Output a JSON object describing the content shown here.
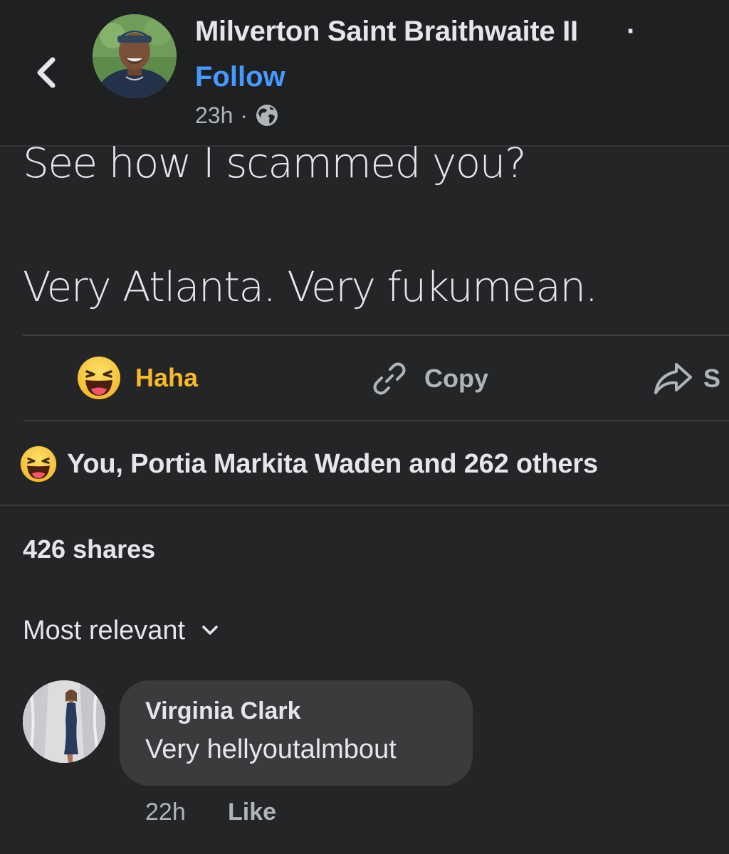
{
  "header": {
    "back_icon": "chevron-left-icon",
    "author_name": "Milverton Saint Braithwaite II",
    "name_separator": "·",
    "follow_label": "Follow",
    "time_ago": "23h",
    "meta_separator": "·",
    "privacy_icon": "globe-icon"
  },
  "post": {
    "lines": [
      "See how I scammed you?",
      "Very Atlanta. Very fukumean."
    ]
  },
  "actions": {
    "haha": {
      "label": "Haha",
      "icon": "haha-emoji-icon",
      "color": "#f7b928"
    },
    "copy": {
      "label": "Copy",
      "icon": "link-icon"
    },
    "share": {
      "label": "S",
      "icon": "share-arrow-icon"
    }
  },
  "reactions": {
    "icon": "haha-emoji-icon",
    "text": "You, Portia Markita Waden and 262 others"
  },
  "shares": {
    "text": "426 shares"
  },
  "comments_sort": {
    "label": "Most relevant",
    "icon": "chevron-down-icon"
  },
  "comments": [
    {
      "author": "Virginia Clark",
      "text": "Very hellyoutalmbout",
      "time": "22h",
      "like_label": "Like"
    }
  ],
  "colors": {
    "background": "#242526",
    "header_background": "#1f2021",
    "link_blue": "#4599ff",
    "haha_yellow": "#f7b928",
    "secondary_text": "#b0b3b8",
    "primary_text": "#e4e6eb",
    "comment_bubble": "#3a3b3c"
  }
}
